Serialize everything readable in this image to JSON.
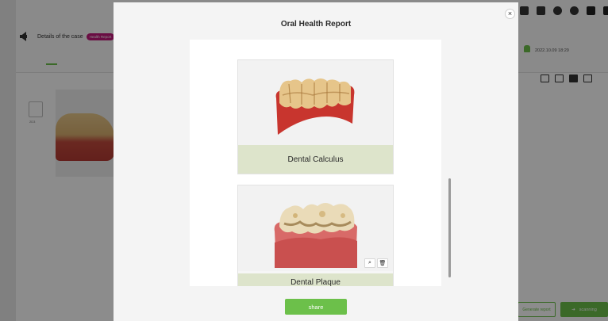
{
  "background": {
    "back_label": "Details of the case",
    "badge_label": "Health Report",
    "doc_label": "2D3",
    "date": "2022.10.09 18:29",
    "report_button": "Generate report",
    "scan_button": "scanning",
    "scan_icon": "arrow-right-icon",
    "top_icons": [
      "import-icon",
      "transfer-icon",
      "settings-icon",
      "user-icon",
      "minimize-icon",
      "close-icon"
    ],
    "tool_icons": [
      "folder-icon",
      "save-icon",
      "export-icon",
      "mail-icon",
      "share-icon"
    ]
  },
  "modal": {
    "title": "Oral Health Report",
    "close_glyph": "×",
    "cards": [
      {
        "label": "Dental Calculus"
      },
      {
        "label": "Dental Plaque",
        "zoom_glyph": "⌕",
        "delete_glyph": "🗑"
      }
    ],
    "share_label": "share"
  },
  "colors": {
    "accent": "#6cc04a",
    "badge": "#c2187a",
    "card_label_bg": "#dde4cb"
  }
}
